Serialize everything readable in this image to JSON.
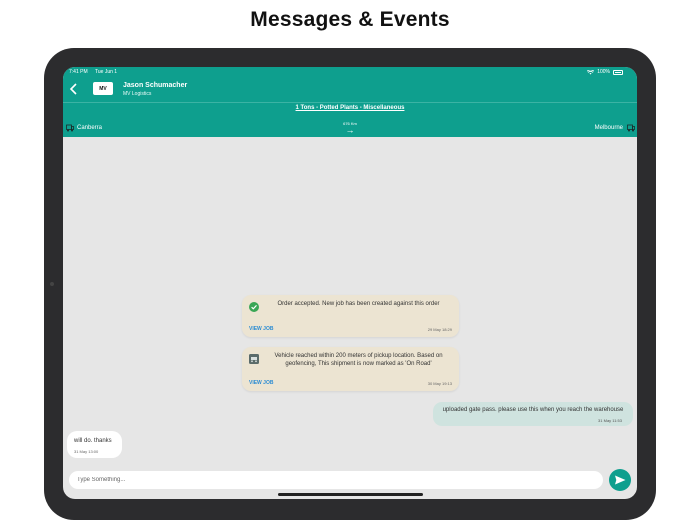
{
  "headline": "Messages & Events",
  "statusbar": {
    "time": "7:41 PM",
    "date": "Tue Jun 1",
    "battery": "100%"
  },
  "chat_header": {
    "contact_name": "Jason Schumacher",
    "company": "MV Logistics",
    "logo_text": "MV"
  },
  "load": {
    "summary": "1 Tons - Potted Plants - Miscellaneous",
    "origin": "Canberra",
    "destination": "Melbourne",
    "distance": "676 Km"
  },
  "events": [
    {
      "icon": "check-circle-icon",
      "text": "Order accepted. New job has been created against this order",
      "link": "VIEW JOB",
      "time": "29 May 18:29"
    },
    {
      "icon": "truck-icon",
      "text": "Vehicle reached within 200 meters of pickup location. Based on geofencing, This shipment is now marked as 'On Road'",
      "link": "VIEW JOB",
      "time": "30 May 19:13"
    }
  ],
  "messages": [
    {
      "direction": "outgoing",
      "text": "uploaded gate pass. please use this when you reach the warehouse",
      "time": "31 May 11:53"
    },
    {
      "direction": "incoming",
      "text": "will do. thanks",
      "time": "31 May 13:00"
    }
  ],
  "composer": {
    "placeholder": "Type Something..."
  },
  "colors": {
    "accent": "#0e9f8e",
    "event_bg": "#ece4d2",
    "outgoing_bg": "#cfe3df",
    "chat_bg": "#e6e6e6",
    "link": "#2a8bd3"
  }
}
